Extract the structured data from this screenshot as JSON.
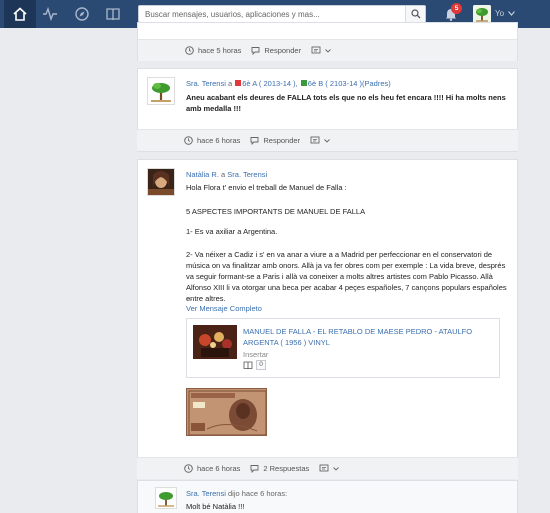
{
  "search": {
    "placeholder": "Buscar mensajes, usuarios, aplicaciones y mas..."
  },
  "header": {
    "notification_count": "5",
    "user_name": "Yo"
  },
  "post1": {
    "time": "hace 5 horas",
    "reply": "Responder"
  },
  "post2": {
    "author": "Sra. Terensi",
    "to": "a",
    "group1": "6è A ( 2013-14 )",
    "group2": "6è B ( 2103-14 )(Padres)",
    "text": "Aneu acabant els deures de FALLA tots els que no els heu fet encara !!!! Hi ha molts nens amb medalla !!!",
    "time": "hace 6 horas",
    "reply": "Responder"
  },
  "post3": {
    "author": "Natàlia R.",
    "to": "a",
    "recipient": "Sra. Terensi",
    "line1": "Hola Flora t' envio el treball de Manuel de Falla :",
    "line2": "5 ASPECTES IMPORTANTS DE MANUEL DE FALLA",
    "line3": "1- Es va axiliar a Argentina.",
    "line4": "2- Va néixer a Cadiz i s' en va anar a viure a a Madrid per perfeccionar en el conservatori de música on va finalitzar amb onors. Allà ja va fer obres com per exemple : La vida breve, després va seguir formant-se a Paris i allà va coneixer a molts altres artistes com Pablo Picasso. Allà Alfonso XIII li va otorgar una beca per acabar 4 peçes españoles, 7 cançons populars españoles entre altres.",
    "ellipsis": "...",
    "more": "Ver Mensaje Completo",
    "attachment": {
      "title": "MANUEL DE FALLA - EL RETABLO DE MAESE PEDRO - ATAULFO ARGENTA ( 1956 ) VINYL",
      "insert": "Insertar",
      "count": "0"
    },
    "time": "hace 6 horas",
    "replies": "2 Respuestas"
  },
  "reply1": {
    "author": "Sra. Terensi",
    "said": "dijo hace 6 horas:",
    "text": "Molt bé Natàlia !!!"
  },
  "colors": {
    "topbar": "#2b4a73",
    "link": "#3b6fae",
    "badge": "#e0393a",
    "group1": "#e0393a",
    "group2": "#3a9a3a"
  }
}
